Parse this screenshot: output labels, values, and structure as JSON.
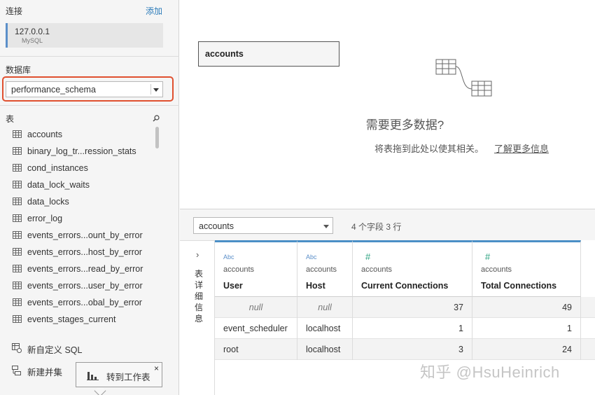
{
  "sidebar": {
    "connection_header": "连接",
    "add_label": "添加",
    "connection": {
      "host": "127.0.0.1",
      "type": "MySQL"
    },
    "database_header": "数据库",
    "database_selected": "performance_schema",
    "table_header": "表",
    "tables": [
      "accounts",
      "binary_log_tr...ression_stats",
      "cond_instances",
      "data_lock_waits",
      "data_locks",
      "error_log",
      "events_errors...ount_by_error",
      "events_errors...host_by_error",
      "events_errors...read_by_error",
      "events_errors...user_by_error",
      "events_errors...obal_by_error",
      "events_stages_current"
    ],
    "custom_sql_label": "新自定义 SQL",
    "new_union_label": "新建并集",
    "goto_sheet_label": "转到工作表",
    "close_glyph": "×"
  },
  "canvas": {
    "table_name": "accounts",
    "need_more_title": "需要更多数据?",
    "need_more_desc": "将表拖到此处以使其相关。",
    "learn_more_link": "了解更多信息"
  },
  "preview": {
    "table_selected": "accounts",
    "field_count": "4 个字段 3 行",
    "detail_arrow": "›",
    "detail_label": "表详细信息",
    "columns": [
      {
        "type_glyph": "Abc",
        "source": "accounts",
        "name": "User"
      },
      {
        "type_glyph": "Abc",
        "source": "accounts",
        "name": "Host"
      },
      {
        "type_glyph": "#",
        "source": "accounts",
        "name": "Current Connections"
      },
      {
        "type_glyph": "#",
        "source": "accounts",
        "name": "Total Connections"
      }
    ],
    "rows": [
      [
        "null",
        "null",
        "37",
        "49"
      ],
      [
        "event_scheduler",
        "localhost",
        "1",
        "1"
      ],
      [
        "root",
        "localhost",
        "3",
        "24"
      ]
    ]
  },
  "watermark": "知乎 @HsuHeinrich",
  "colors": {
    "accent_blue": "#4b8fc6",
    "link_blue": "#2b7bb9",
    "highlight_red": "#e0502f",
    "numeric_green": "#2aa27f"
  }
}
